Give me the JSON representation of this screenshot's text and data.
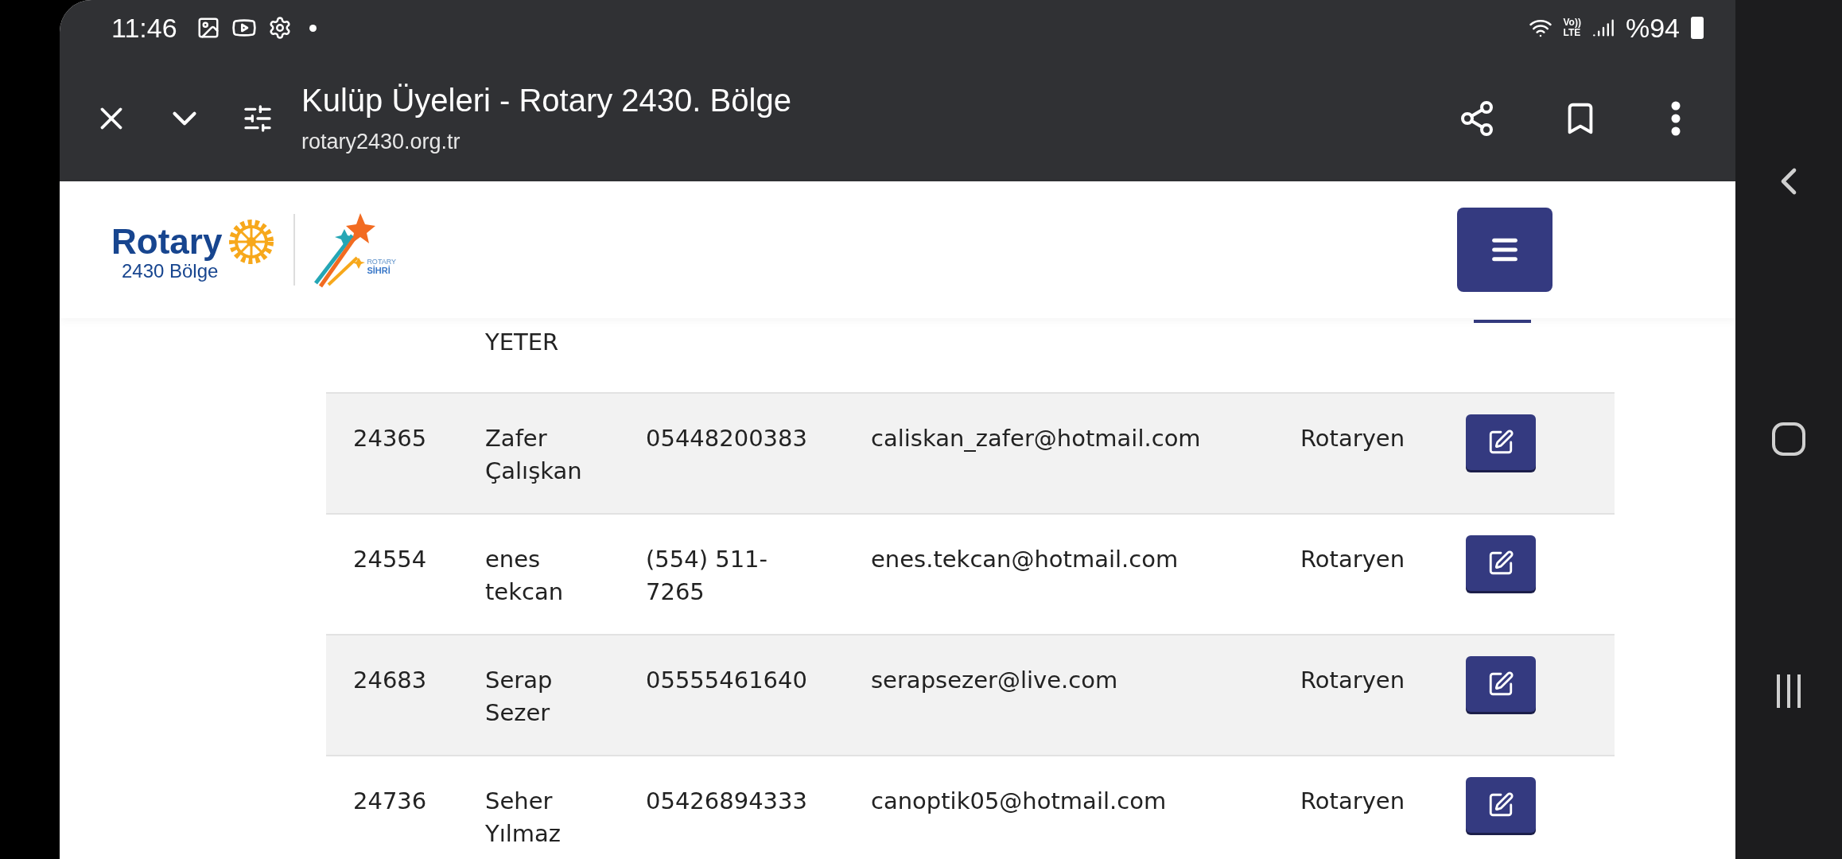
{
  "status_bar": {
    "time": "11:46",
    "network": {
      "top": "Vo))",
      "bottom": "LTE"
    },
    "battery": "%94"
  },
  "browser": {
    "title": "Kulüp Üyeleri - Rotary 2430. Bölge",
    "url": "rotary2430.org.tr"
  },
  "logo": {
    "wordmark": "Rotary",
    "district": "2430 Bölge",
    "campaign_top": "ROTARY",
    "campaign_bottom": "SİHRİ"
  },
  "partial_row": {
    "name": "YETER"
  },
  "rows": [
    {
      "id": "24365",
      "name": "Zafer Çalışkan",
      "phone": "05448200383",
      "email": "caliskan_zafer@hotmail.com",
      "role": "Rotaryen"
    },
    {
      "id": "24554",
      "name": "enes tekcan",
      "phone": "(554) 511-7265",
      "email": "enes.tekcan@hotmail.com",
      "role": "Rotaryen"
    },
    {
      "id": "24683",
      "name": "Serap Sezer",
      "phone": "05555461640",
      "email": "serapsezer@live.com",
      "role": "Rotaryen"
    },
    {
      "id": "24736",
      "name": "Seher Yılmaz",
      "phone": "05426894333",
      "email": "canoptik05@hotmail.com",
      "role": "Rotaryen"
    }
  ]
}
